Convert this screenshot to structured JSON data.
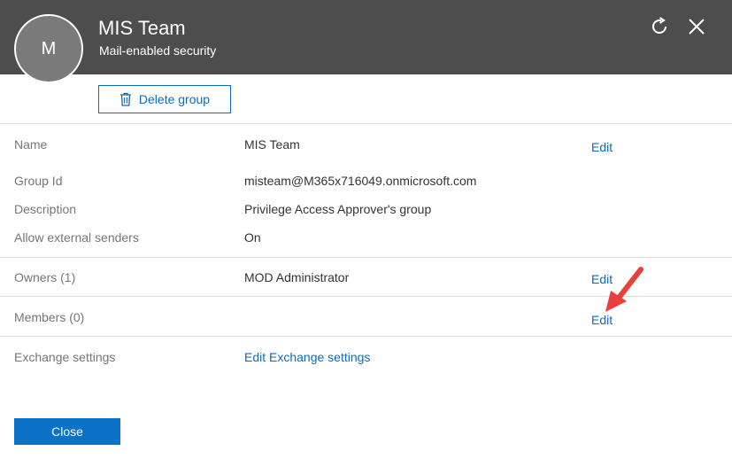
{
  "header": {
    "avatar_initial": "M",
    "title": "MIS Team",
    "subtitle": "Mail-enabled security",
    "refresh_icon": "refresh-icon",
    "close_icon": "close-icon"
  },
  "toolbar": {
    "delete_label": "Delete group",
    "delete_icon": "trash-icon"
  },
  "details": {
    "name_label": "Name",
    "name_value": "MIS Team",
    "edit_label": "Edit",
    "group_id_label": "Group Id",
    "group_id_value": "misteam@M365x716049.onmicrosoft.com",
    "description_label": "Description",
    "description_value": "Privilege Access Approver's group",
    "external_label": "Allow external senders",
    "external_value": "On"
  },
  "owners": {
    "label": "Owners (1)",
    "value": "MOD Administrator",
    "edit_label": "Edit"
  },
  "members": {
    "label": "Members (0)",
    "edit_label": "Edit"
  },
  "exchange": {
    "label": "Exchange settings",
    "link_label": "Edit Exchange settings"
  },
  "footer": {
    "close_label": "Close"
  },
  "colors": {
    "header_bg": "#4d4d4d",
    "accent": "#0b6bbf",
    "annotation_arrow": "#e8413c"
  }
}
